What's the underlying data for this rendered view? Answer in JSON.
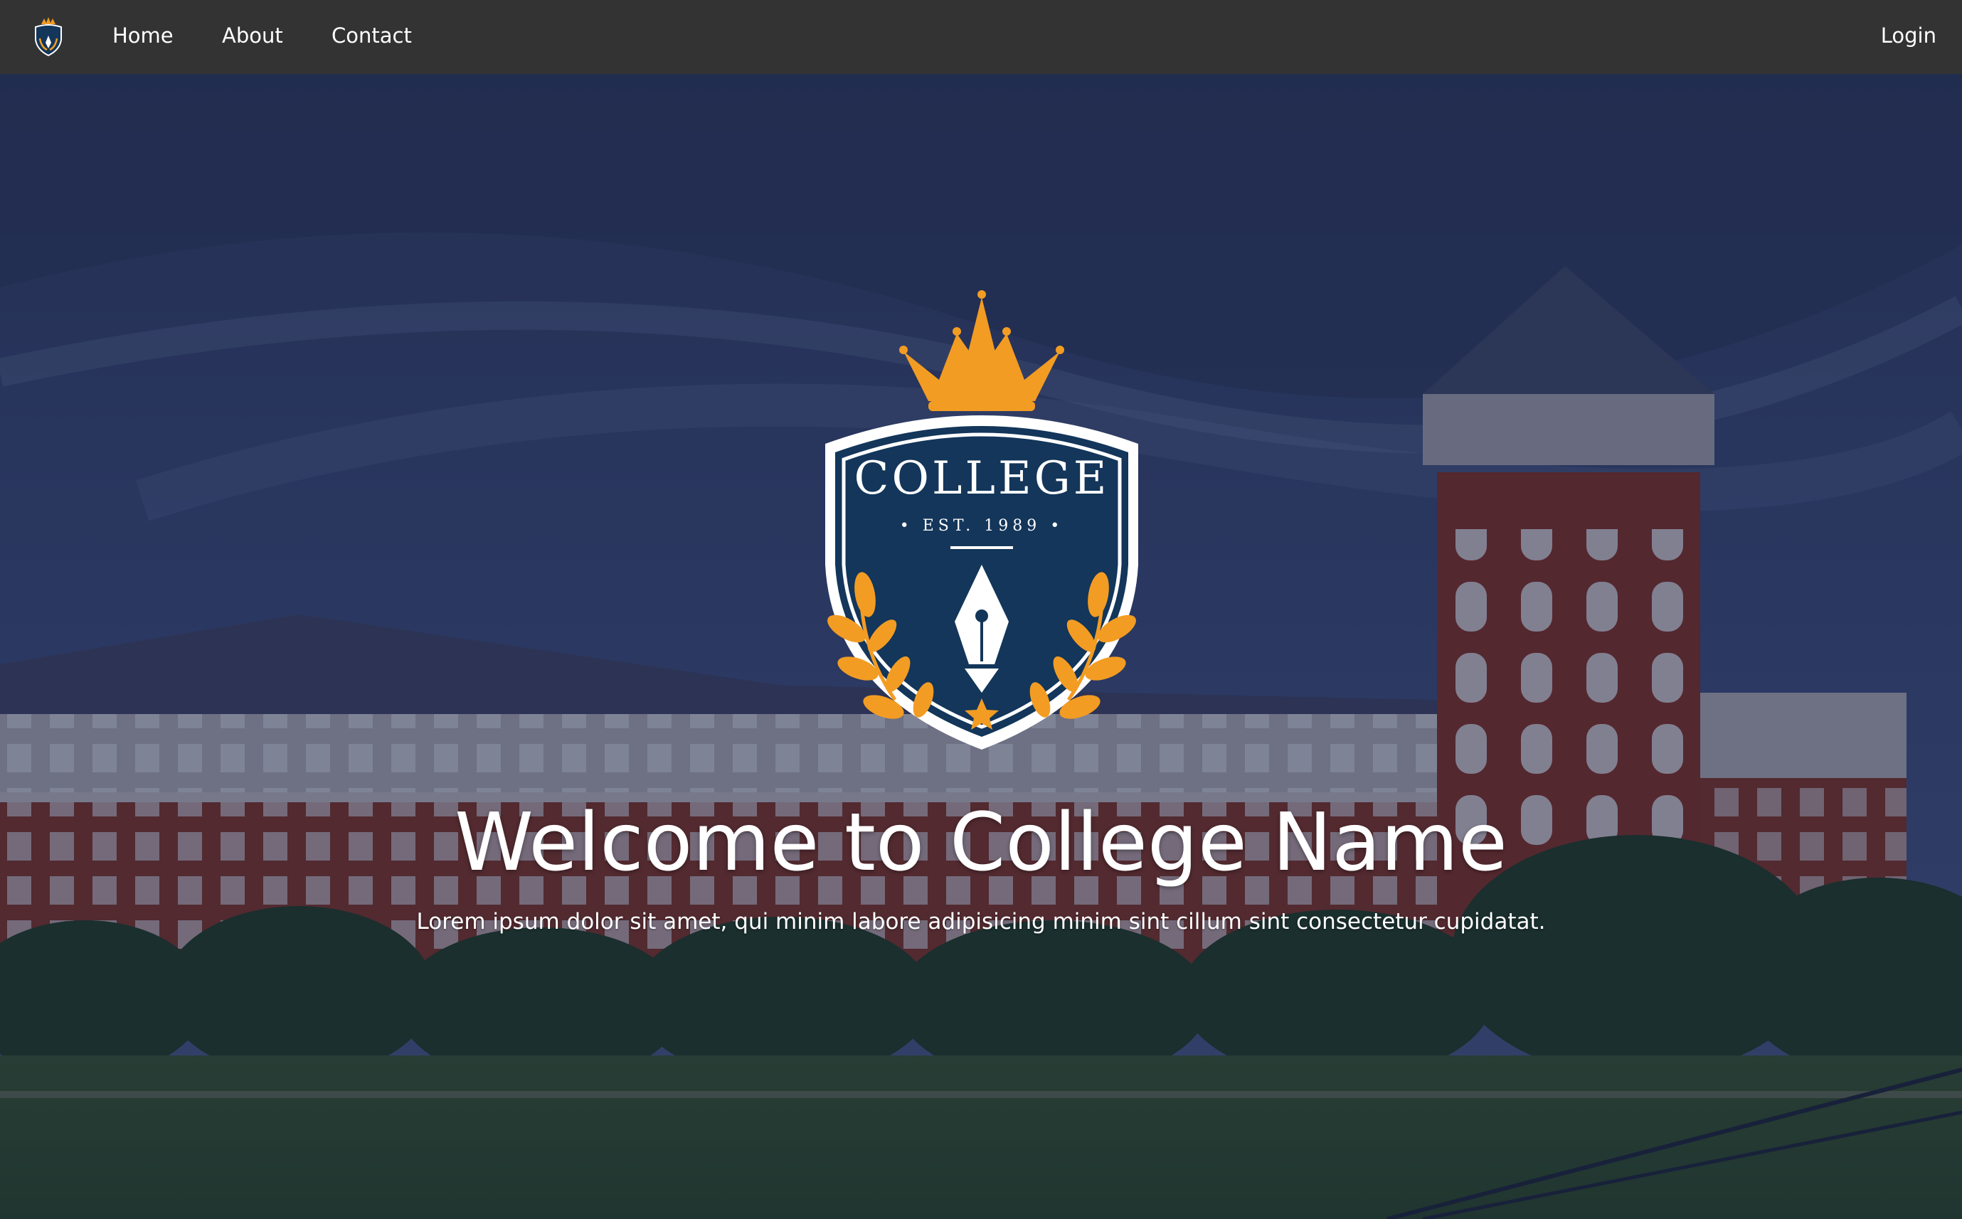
{
  "nav": {
    "logo_name": "college-crest-logo",
    "links": [
      {
        "label": "Home"
      },
      {
        "label": "About"
      },
      {
        "label": "Contact"
      }
    ],
    "login_label": "Login"
  },
  "hero": {
    "crest": {
      "wordmark": "COLLEGE",
      "established": "• EST. 1989 •"
    },
    "title": "Welcome to College Name",
    "subtitle": "Lorem ipsum dolor sit amet, qui minim labore adipisicing minim sint cillum sint consectetur cupidatat."
  },
  "colors": {
    "navbar": "#333333",
    "crest_navy": "#13365a",
    "crest_gold": "#f39c23",
    "text": "#ffffff"
  }
}
